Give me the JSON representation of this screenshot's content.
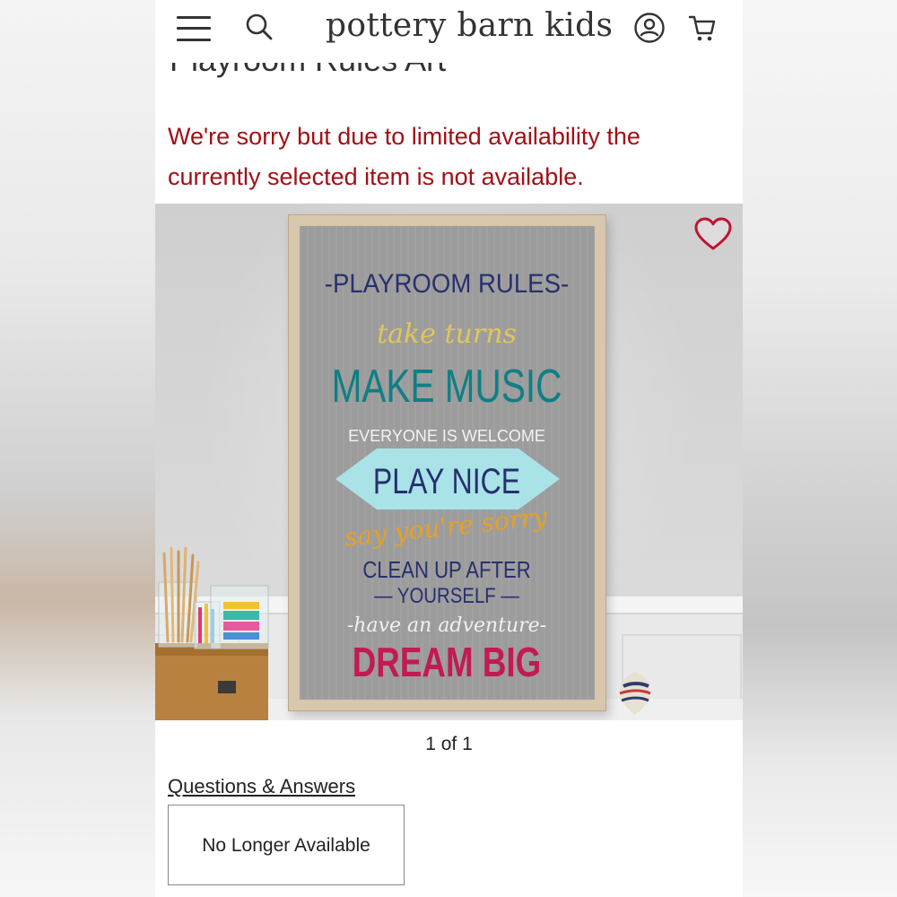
{
  "header": {
    "brand": "pottery barn kids",
    "icons": [
      "menu-icon",
      "search-icon",
      "account-icon",
      "cart-icon"
    ]
  },
  "product": {
    "title": "Playroom Rules Art",
    "availability_notice": "We're sorry but due to limited availability the currently selected item is not available.",
    "image_counter": "1 of 1",
    "favorite_icon": "heart-icon"
  },
  "sign": {
    "heading": "-PLAYROOM RULES-",
    "lines": [
      "take turns",
      "MAKE MUSIC",
      "EVERYONE IS WELCOME",
      "PLAY NICE",
      "say you're sorry",
      "CLEAN UP AFTER",
      "— YOURSELF —",
      "-have an adventure-",
      "DREAM BIG"
    ]
  },
  "links": {
    "questions_answers": "Questions & Answers"
  },
  "status": {
    "label": "No Longer Available"
  },
  "colors": {
    "notice_red": "#a30f16",
    "heart_red": "#c4122f",
    "sign_navy": "#27306e",
    "sign_teal": "#0f7f84",
    "sign_yellow": "#e2c55a",
    "sign_orange": "#e8a022",
    "sign_magenta": "#c21a52",
    "sign_diamond": "#a9e2e7"
  }
}
